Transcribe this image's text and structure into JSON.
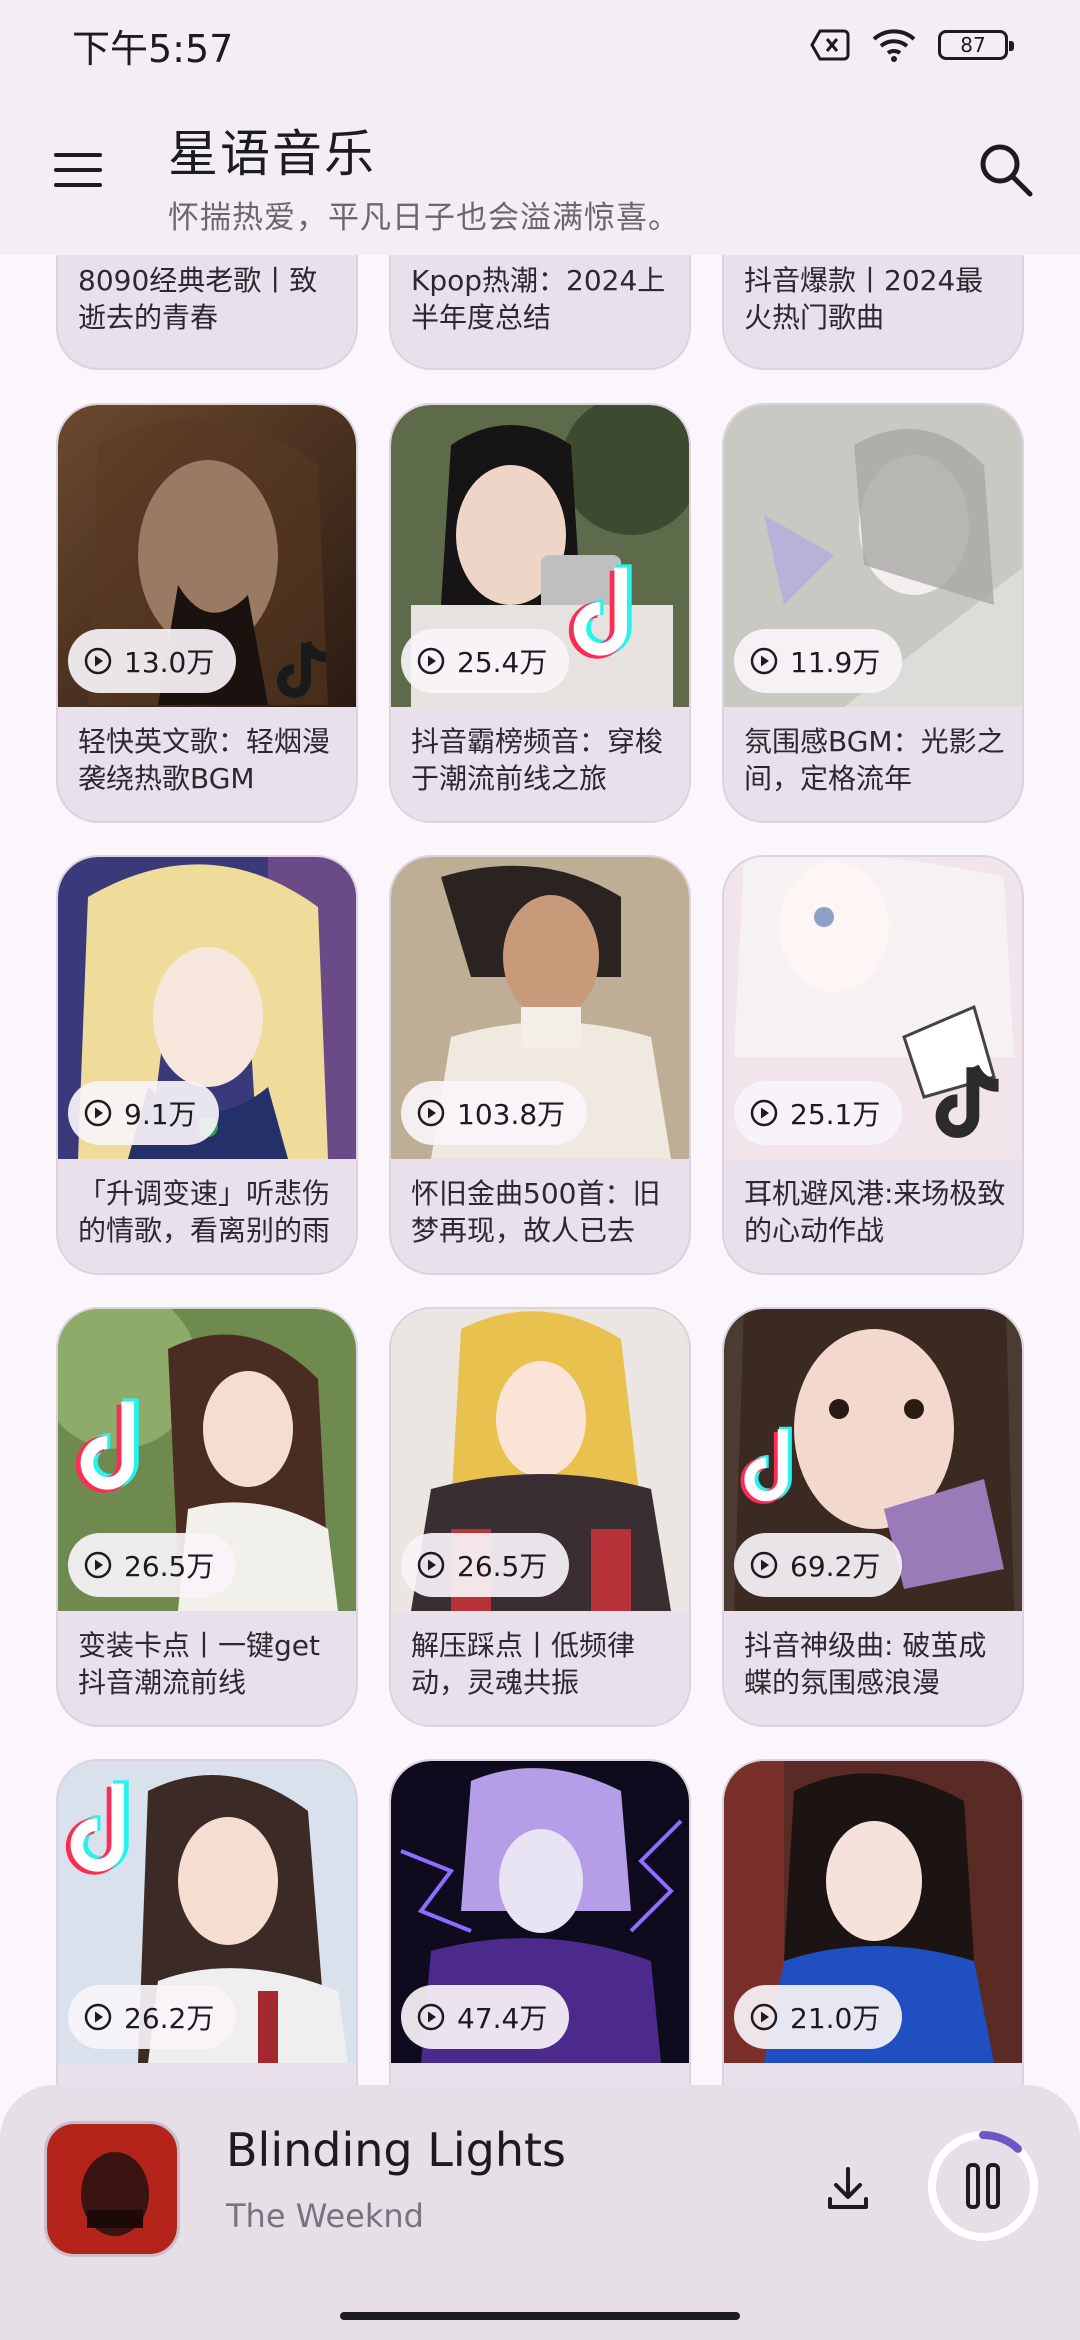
{
  "status_bar": {
    "time": "下午5:57",
    "battery": "87"
  },
  "header": {
    "title": "星语音乐",
    "subtitle": "怀揣热爱，平凡日子也会溢满惊喜。"
  },
  "playlists_partial": [
    {
      "title": "8090经典老歌丨致逝去的青春"
    },
    {
      "title": "Kpop热潮：2024上半年度总结"
    },
    {
      "title": "抖音爆款丨2024最火热门歌曲"
    }
  ],
  "playlists": [
    {
      "plays": "13.0万",
      "title": "轻快英文歌：轻烟漫袭绕热歌BGM"
    },
    {
      "plays": "25.4万",
      "title": "抖音霸榜频音：穿梭于潮流前线之旅"
    },
    {
      "plays": "11.9万",
      "title": "氛围感BGM：光影之间，定格流年"
    },
    {
      "plays": "9.1万",
      "title": "「升调变速」听悲伤的情歌，看离别的雨"
    },
    {
      "plays": "103.8万",
      "title": "怀旧金曲500首：旧梦再现，故人已去"
    },
    {
      "plays": "25.1万",
      "title": "耳机避风港:来场极致的心动作战"
    },
    {
      "plays": "26.5万",
      "title": "变装卡点丨一键get抖音潮流前线"
    },
    {
      "plays": "26.5万",
      "title": "解压踩点丨低频律动，灵魂共振"
    },
    {
      "plays": "69.2万",
      "title": "抖音神级曲: 破茧成蝶的氛围感浪漫"
    },
    {
      "plays": "26.2万",
      "title": ""
    },
    {
      "plays": "47.4万",
      "title": ""
    },
    {
      "plays": "21.0万",
      "title": ""
    }
  ],
  "player": {
    "track_title": "Blinding Lights",
    "artist": "The Weeknd",
    "progress": 0.12
  },
  "colors": {
    "accent": "#6b57c7",
    "card_bg": "#e8e0ea",
    "header_bg": "#f2eef3"
  }
}
